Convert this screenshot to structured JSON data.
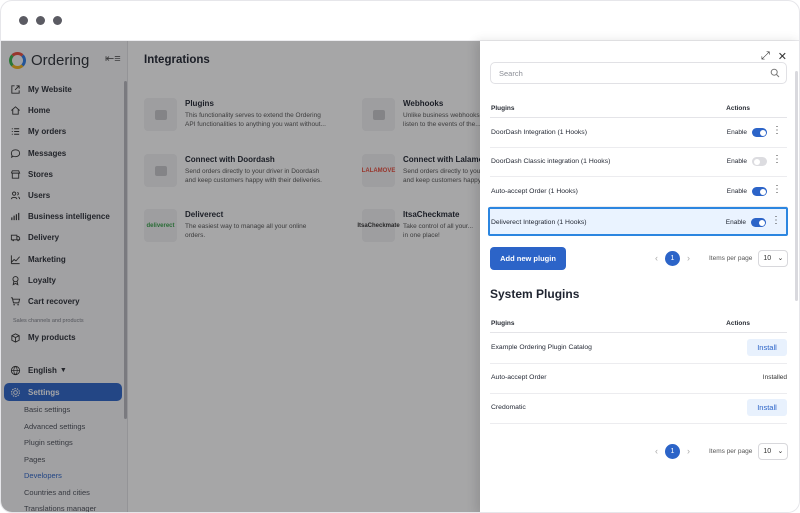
{
  "window": {
    "controls": [
      "dot",
      "dot",
      "dot"
    ]
  },
  "brand": {
    "name": "Ordering",
    "collapse_icon": "≡"
  },
  "sidebar": {
    "items": [
      {
        "label": "My Website",
        "icon": "external-link-icon"
      },
      {
        "label": "Home",
        "icon": "home-icon"
      },
      {
        "label": "My orders",
        "icon": "list-icon"
      },
      {
        "label": "Messages",
        "icon": "chat-icon"
      },
      {
        "label": "Stores",
        "icon": "store-icon"
      },
      {
        "label": "Users",
        "icon": "users-icon"
      },
      {
        "label": "Business intelligence",
        "icon": "bar-chart-icon"
      },
      {
        "label": "Delivery",
        "icon": "truck-icon"
      },
      {
        "label": "Marketing",
        "icon": "trend-icon"
      },
      {
        "label": "Loyalty",
        "icon": "badge-icon"
      },
      {
        "label": "Cart recovery",
        "icon": "cart-icon"
      }
    ],
    "section_label": "Sales channels and products",
    "products": {
      "label": "My products",
      "icon": "box-icon"
    },
    "language": {
      "label": "English",
      "icon": "globe-icon"
    },
    "settings": {
      "label": "Settings",
      "icon": "gear-icon"
    },
    "sub_items": [
      "Basic settings",
      "Advanced settings",
      "Plugin settings",
      "Pages",
      "Developers",
      "Countries and cities",
      "Translations manager"
    ],
    "active_sub": "Developers"
  },
  "main": {
    "title": "Integrations",
    "cards": [
      {
        "title": "Plugins",
        "desc": "This functionality serves to extend the Ordering",
        "desc2": "API functionalities to anything you want without...",
        "thumb": ""
      },
      {
        "title": "Webhooks",
        "desc": "Unlike business webhooks...",
        "desc2": "listen to the events of the...",
        "thumb": ""
      },
      {
        "title": "Connect with Doordash",
        "desc": "Send orders directly to your driver in Doordash",
        "desc2": "and keep customers happy with their deliveries.",
        "thumb": ""
      },
      {
        "title": "Connect with Lalamove",
        "desc": "Send orders directly to your...",
        "desc2": "and keep customers happy...",
        "thumb": "LALAMOVE"
      },
      {
        "title": "Deliverect",
        "desc": "The easiest way to manage all your online",
        "desc2": "orders.",
        "thumb": "deliverect"
      },
      {
        "title": "ItsaCheckmate",
        "desc": "Take control of all your...",
        "desc2": "in one place!",
        "thumb": "ItsaCheckmate"
      }
    ]
  },
  "panel": {
    "search_placeholder": "Search",
    "plugins_header": {
      "col1": "Plugins",
      "col2": "Actions"
    },
    "plugins": [
      {
        "name": "DoorDash Integration (1 Hooks)",
        "enable_label": "Enable",
        "enabled": true
      },
      {
        "name": "DoorDash Classic integration (1 Hooks)",
        "enable_label": "Enable",
        "enabled": false
      },
      {
        "name": "Auto-accept Order (1 Hooks)",
        "enable_label": "Enable",
        "enabled": true
      },
      {
        "name": "Deliverect Integration (1 Hooks)",
        "enable_label": "Enable",
        "enabled": true
      }
    ],
    "add_button": "Add new plugin",
    "pager1": {
      "page": "1",
      "items_label": "Items per page",
      "per_page": "10"
    },
    "system_title": "System Plugins",
    "system_header": {
      "col1": "Plugins",
      "col2": "Actions"
    },
    "system_plugins": [
      {
        "name": "Example Ordering Plugin Catalog",
        "action": "Install",
        "action_type": "button"
      },
      {
        "name": "Auto-accept Order",
        "action": "Installed",
        "action_type": "text"
      },
      {
        "name": "Credomatic",
        "action": "Install",
        "action_type": "button"
      }
    ],
    "pager2": {
      "page": "1",
      "items_label": "Items per page",
      "per_page": "10"
    }
  },
  "colors": {
    "accent": "#2c64c8",
    "highlight_border": "#2c86e0",
    "highlight_bg": "#eaf3ff"
  }
}
